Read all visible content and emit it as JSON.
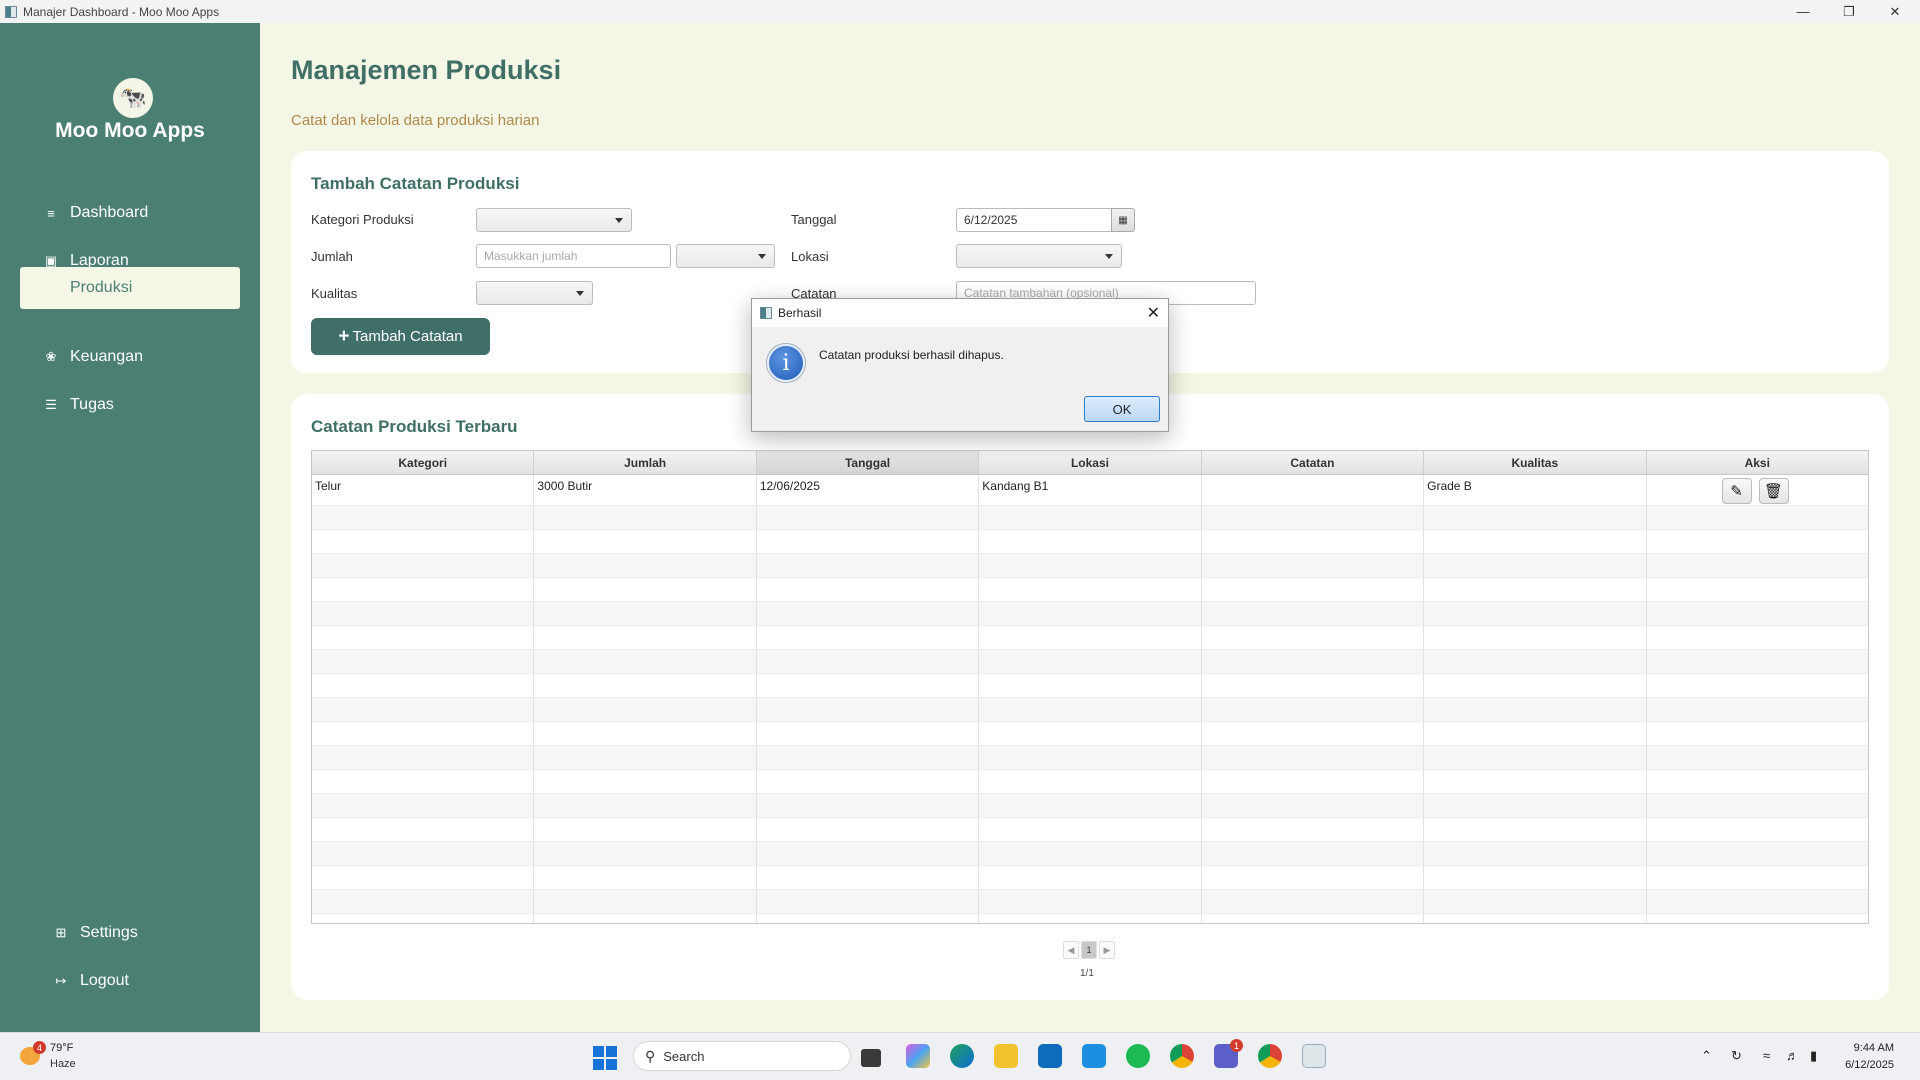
{
  "window": {
    "title": "Manajer Dashboard - Moo Moo Apps"
  },
  "sidebar": {
    "logo_icon": "cow-icon",
    "app_name": "Moo Moo Apps",
    "items": [
      {
        "label": "Dashboard",
        "icon": "dashboard-icon"
      },
      {
        "label": "Laporan",
        "icon": "chart-icon"
      },
      {
        "label": "Produksi",
        "icon": "production-icon",
        "active": true
      },
      {
        "label": "Keuangan",
        "icon": "money-icon"
      },
      {
        "label": "Tugas",
        "icon": "tasks-icon"
      }
    ],
    "settings": "Settings",
    "logout": "Logout"
  },
  "page": {
    "title": "Manajemen Produksi",
    "subtitle": "Catat dan kelola data produksi harian"
  },
  "form": {
    "title": "Tambah Catatan Produksi",
    "kategori_label": "Kategori Produksi",
    "jumlah_label": "Jumlah",
    "jumlah_placeholder": "Masukkan jumlah",
    "kualitas_label": "Kualitas",
    "tanggal_label": "Tanggal",
    "tanggal_value": "6/12/2025",
    "lokasi_label": "Lokasi",
    "catatan_label": "Catatan",
    "catatan_placeholder": "Catatan tambahan (opsional)",
    "add_button": "Tambah Catatan"
  },
  "table": {
    "title": "Catatan Produksi Terbaru",
    "columns": [
      "Kategori",
      "Jumlah",
      "Tanggal",
      "Lokasi",
      "Catatan",
      "Kualitas",
      "Aksi"
    ],
    "rows": [
      {
        "kategori": "Telur",
        "jumlah": "3000 Butir",
        "tanggal": "12/06/2025",
        "lokasi": "Kandang B1",
        "catatan": "",
        "kualitas": "Grade B"
      }
    ],
    "pager": {
      "current": "1",
      "count": "1/1"
    }
  },
  "dialog": {
    "title": "Berhasil",
    "message": "Catatan produksi berhasil dihapus.",
    "ok": "OK"
  },
  "taskbar": {
    "weather_temp": "79°F",
    "weather_desc": "Haze",
    "weather_badge": "4",
    "search": "Search",
    "time": "9:44 AM",
    "date": "6/12/2025",
    "teams_badge": "1"
  }
}
